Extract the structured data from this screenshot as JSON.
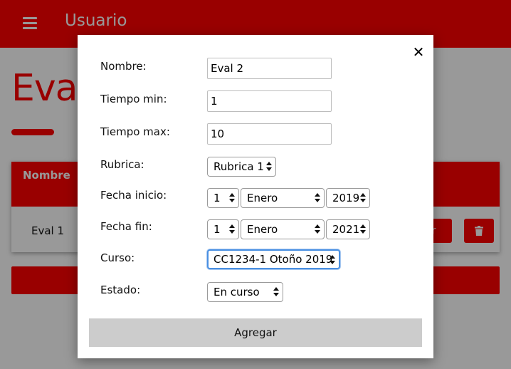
{
  "app": {
    "title": "Usuario"
  },
  "page": {
    "title": "Eval",
    "table": {
      "column_header": "Nombre",
      "rows": [
        {
          "name": "Eval 1",
          "view_label": "er"
        }
      ]
    }
  },
  "modal": {
    "close_glyph": "✕",
    "fields": {
      "nombre": {
        "label": "Nombre:",
        "value": "Eval 2"
      },
      "tiempo_min": {
        "label": "Tiempo min:",
        "value": "1"
      },
      "tiempo_max": {
        "label": "Tiempo max:",
        "value": "10"
      },
      "rubrica": {
        "label": "Rubrica:",
        "value": "Rubrica 1"
      },
      "fecha_inicio": {
        "label": "Fecha inicio:",
        "day": "1",
        "month": "Enero",
        "year": "2019"
      },
      "fecha_fin": {
        "label": "Fecha fin:",
        "day": "1",
        "month": "Enero",
        "year": "2021"
      },
      "curso": {
        "label": "Curso:",
        "value": "CC1234-1 Otoño 2019"
      },
      "estado": {
        "label": "Estado:",
        "value": "En curso"
      }
    },
    "submit_label": "Agregar"
  },
  "colors": {
    "brand": "#ff0000",
    "submit": "#cccccc",
    "focus": "#4a90e2"
  }
}
